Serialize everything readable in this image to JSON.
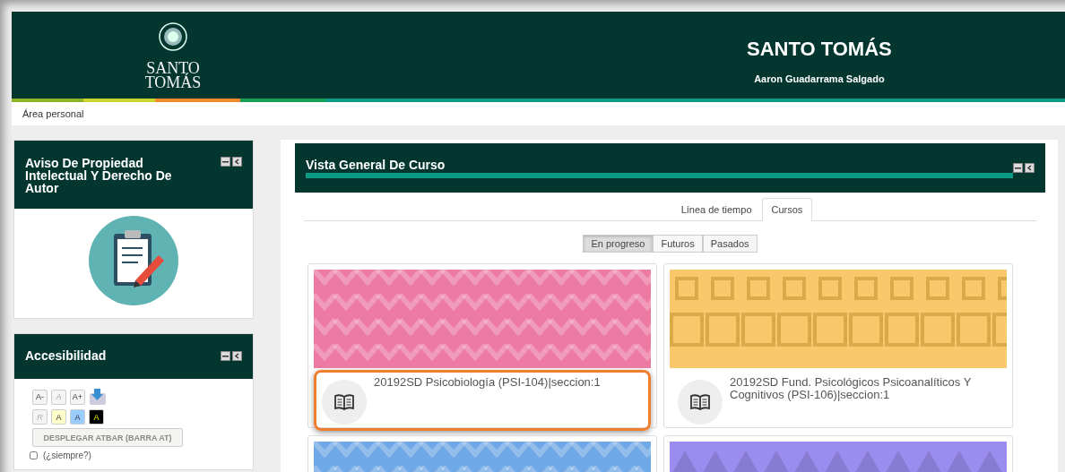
{
  "header": {
    "logo_text": [
      "SANTO",
      "TOMÁS"
    ],
    "title": "SANTO TOMÁS",
    "user": "Aaron Guadarrama Salgado"
  },
  "breadcrumb": "Área personal",
  "blocks": [
    {
      "kind": "notice",
      "title": "Aviso De Propiedad Intelectual Y Derecho De Autor"
    },
    {
      "kind": "accessibility",
      "title": "Accesibilidad",
      "font_buttons": [
        {
          "label": "A-",
          "disabled": false
        },
        {
          "label": "A",
          "disabled": true
        },
        {
          "label": "A+",
          "disabled": false
        }
      ],
      "color_buttons": [
        {
          "label": "R",
          "disabled": true,
          "color": "#f4f4f4"
        },
        {
          "label": "A",
          "disabled": false,
          "color": "#ffffcc"
        },
        {
          "label": "A",
          "disabled": false,
          "color": "#99ccff"
        },
        {
          "label": "A",
          "disabled": false,
          "color": "#000000"
        }
      ],
      "atbar_button": "DESPLEGAR ATBAR (BARRA AT)",
      "always": {
        "label": "(¿siempre?)",
        "checked": false
      }
    }
  ],
  "overview": {
    "title": "Vista General De Curso",
    "tabs": [
      {
        "label": "Línea de tiempo",
        "selected": false
      },
      {
        "label": "Cursos",
        "selected": true
      }
    ],
    "filters": [
      {
        "label": "En progreso",
        "selected": true
      },
      {
        "label": "Futuros",
        "selected": false
      },
      {
        "label": "Pasados",
        "selected": false
      }
    ],
    "courses": [
      {
        "kind": "diamonds",
        "color": "#ec7aa3",
        "title": "20192SD Psicobiología (PSI-104)|seccion:1",
        "highlighted": true
      },
      {
        "kind": "squares",
        "color": "#f8c86a",
        "title": "20192SD Fund. Psicológicos Psicoanalíticos Y Cognitivos (PSI-106)|seccion:1",
        "highlighted": false
      },
      {
        "kind": "diamonds",
        "color": "#6fa8e6"
      },
      {
        "kind": "triangles",
        "color": "#9b8cf0"
      }
    ]
  }
}
